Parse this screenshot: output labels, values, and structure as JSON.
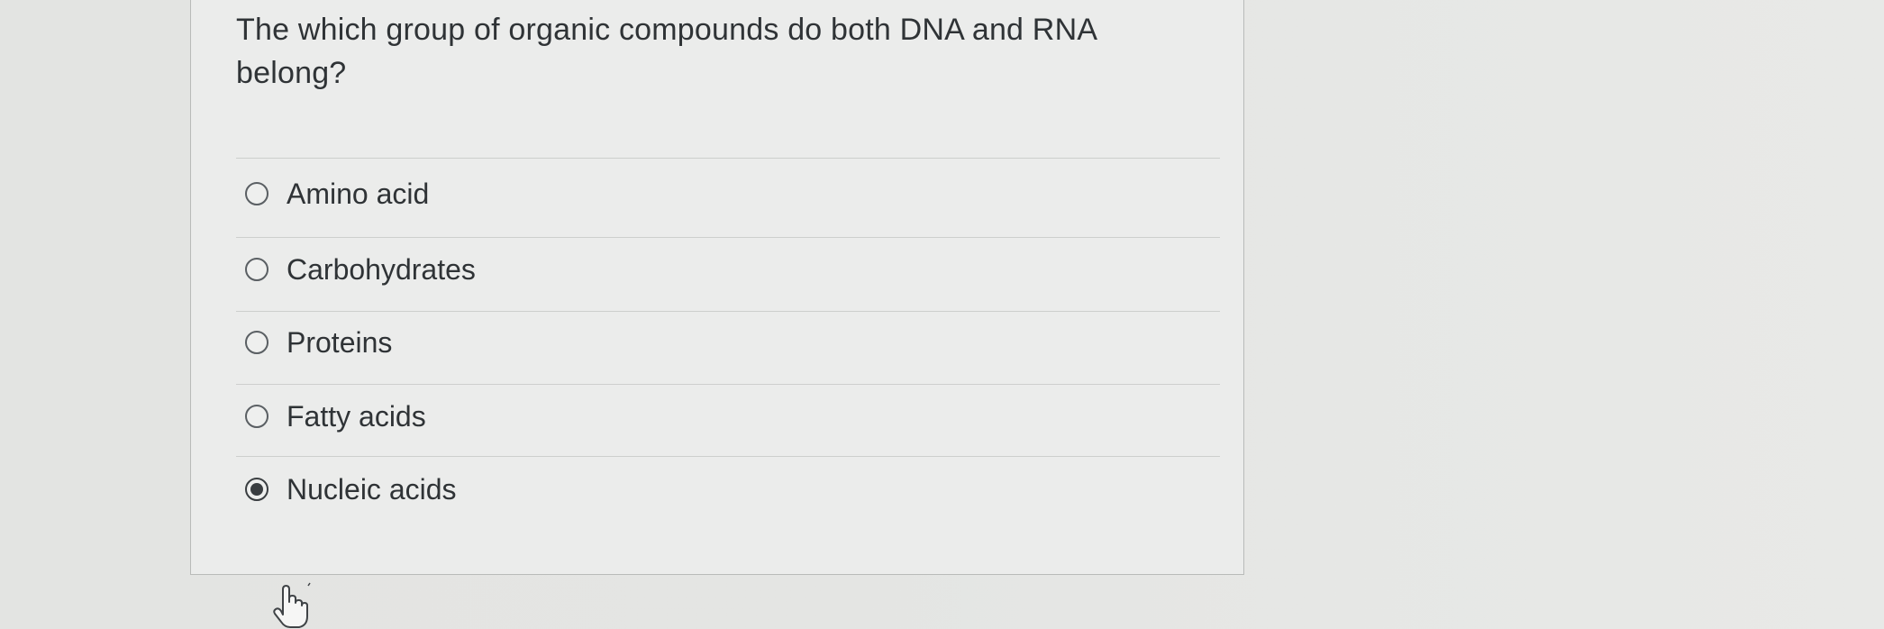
{
  "question": {
    "text": "The which group of organic compounds do both DNA and RNA belong?"
  },
  "options": [
    {
      "label": "Amino acid",
      "selected": false
    },
    {
      "label": "Carbohydrates",
      "selected": false
    },
    {
      "label": "Proteins",
      "selected": false
    },
    {
      "label": "Fatty acids",
      "selected": false
    },
    {
      "label": "Nucleic acids",
      "selected": true
    }
  ],
  "icons": {
    "radio": "radio-button-icon",
    "cursor": "hand-pointer-icon"
  },
  "colors": {
    "text": "#2f3336",
    "card_background": "#ebeceb",
    "card_border": "#b9bbb9"
  }
}
